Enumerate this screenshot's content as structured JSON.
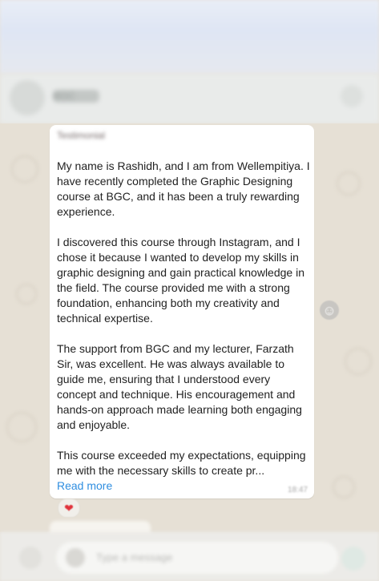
{
  "header": {
    "contact_name": "BGC"
  },
  "message": {
    "sender": "Testimonial",
    "body": "My name is Rashidh, and I am from Wellempitiya. I have recently completed the Graphic Designing course at BGC, and it has been a truly rewarding experience.\n\nI discovered this course through Instagram, and I chose it because I wanted to develop my skills in graphic designing and gain practical knowledge in the field. The course provided me with a strong foundation, enhancing both my creativity and technical expertise.\n\nThe support from BGC and my lecturer, Farzath Sir, was excellent. He was always available to guide me, ensuring that I understood every concept and technique. His encouragement and hands-on approach made learning both engaging and enjoyable.\n\nThis course exceeded my expectations, equipping me with the necessary skills to create pr...",
    "read_more": "Read more",
    "time": "18:47",
    "reaction": "❤"
  },
  "composer": {
    "placeholder": "Type a message"
  },
  "icons": {
    "reaction_icon": "heart-icon",
    "emoji_react_icon": "smiley-icon"
  }
}
